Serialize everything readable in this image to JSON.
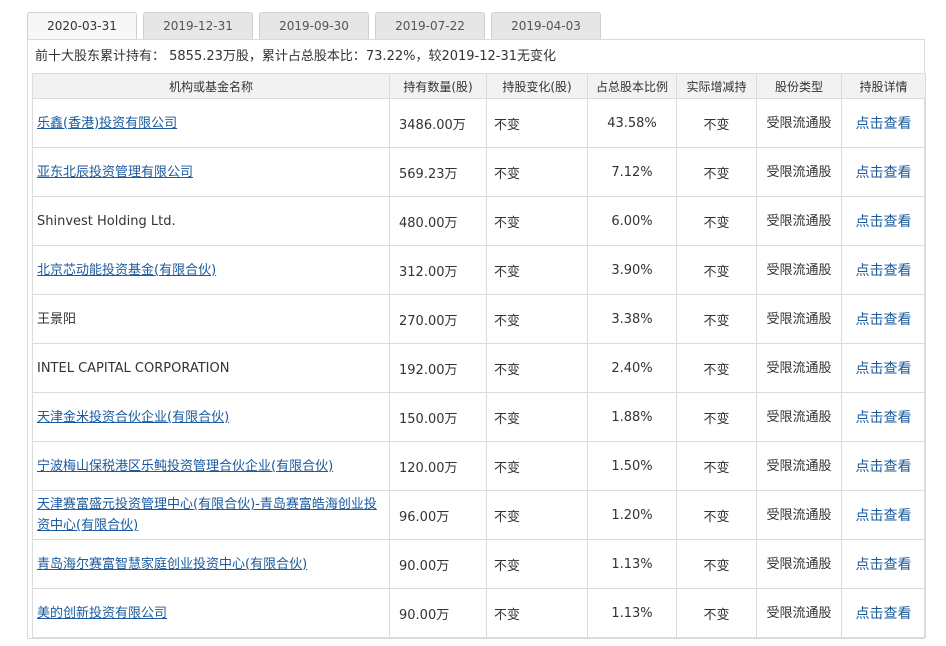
{
  "tabs": [
    "2020-03-31",
    "2019-12-31",
    "2019-09-30",
    "2019-07-22",
    "2019-04-03"
  ],
  "active_tab": 0,
  "summary": "前十大股东累计持有： 5855.23万股，累计占总股本比：73.22%，较2019-12-31无变化",
  "columns": [
    "机构或基金名称",
    "持有数量(股)",
    "持股变化(股)",
    "占总股本比例",
    "实际增减持",
    "股份类型",
    "持股详情"
  ],
  "rows": [
    {
      "name": "乐鑫(香港)投资有限公司",
      "link": true,
      "qty": "3486.00万",
      "change": "不变",
      "pct": "43.58%",
      "actual": "不变",
      "type": "受限流通股",
      "detail": "点击查看"
    },
    {
      "name": "亚东北辰投资管理有限公司",
      "link": true,
      "qty": "569.23万",
      "change": "不变",
      "pct": "7.12%",
      "actual": "不变",
      "type": "受限流通股",
      "detail": "点击查看"
    },
    {
      "name": "Shinvest Holding Ltd.",
      "link": false,
      "qty": "480.00万",
      "change": "不变",
      "pct": "6.00%",
      "actual": "不变",
      "type": "受限流通股",
      "detail": "点击查看"
    },
    {
      "name": "北京芯动能投资基金(有限合伙)",
      "link": true,
      "qty": "312.00万",
      "change": "不变",
      "pct": "3.90%",
      "actual": "不变",
      "type": "受限流通股",
      "detail": "点击查看"
    },
    {
      "name": "王景阳",
      "link": false,
      "qty": "270.00万",
      "change": "不变",
      "pct": "3.38%",
      "actual": "不变",
      "type": "受限流通股",
      "detail": "点击查看"
    },
    {
      "name": "INTEL CAPITAL CORPORATION",
      "link": false,
      "qty": "192.00万",
      "change": "不变",
      "pct": "2.40%",
      "actual": "不变",
      "type": "受限流通股",
      "detail": "点击查看"
    },
    {
      "name": "天津金米投资合伙企业(有限合伙)",
      "link": true,
      "qty": "150.00万",
      "change": "不变",
      "pct": "1.88%",
      "actual": "不变",
      "type": "受限流通股",
      "detail": "点击查看"
    },
    {
      "name": "宁波梅山保税港区乐鲀投资管理合伙企业(有限合伙)",
      "link": true,
      "qty": "120.00万",
      "change": "不变",
      "pct": "1.50%",
      "actual": "不变",
      "type": "受限流通股",
      "detail": "点击查看"
    },
    {
      "name": "天津赛富盛元投资管理中心(有限合伙)-青岛赛富皓海创业投资中心(有限合伙)",
      "link": true,
      "qty": "96.00万",
      "change": "不变",
      "pct": "1.20%",
      "actual": "不变",
      "type": "受限流通股",
      "detail": "点击查看"
    },
    {
      "name": "青岛海尔赛富智慧家庭创业投资中心(有限合伙)",
      "link": true,
      "qty": "90.00万",
      "change": "不变",
      "pct": "1.13%",
      "actual": "不变",
      "type": "受限流通股",
      "detail": "点击查看"
    },
    {
      "name": "美的创新投资有限公司",
      "link": true,
      "qty": "90.00万",
      "change": "不变",
      "pct": "1.13%",
      "actual": "不变",
      "type": "受限流通股",
      "detail": "点击查看"
    }
  ]
}
